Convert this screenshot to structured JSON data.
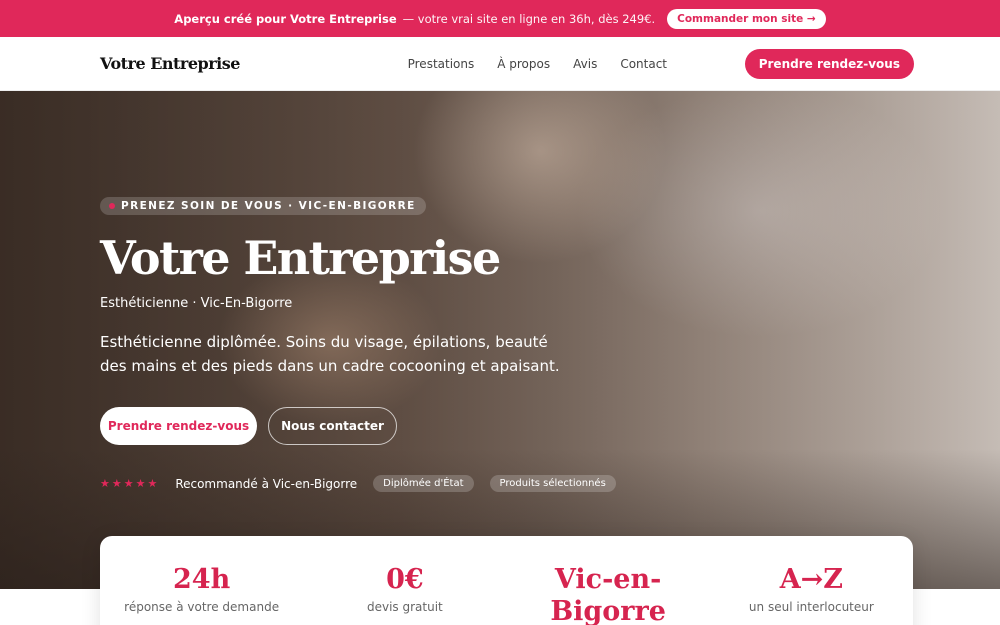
{
  "promo": {
    "strong": "Aperçu créé pour Votre Entreprise",
    "rest": "— votre vrai site en ligne en 36h, dès 249€.",
    "button": "Commander mon site →"
  },
  "nav": {
    "brand": "Votre Entreprise",
    "links": [
      "Prestations",
      "À propos",
      "Avis",
      "Contact"
    ],
    "cta": "Prendre rendez-vous"
  },
  "hero": {
    "eyebrow": "PRENEZ SOIN DE VOUS · VIC-EN-BIGORRE",
    "title": "Votre Entreprise",
    "subtitle": "Esthéticienne · Vic-En-Bigorre",
    "description": "Esthéticienne diplômée. Soins du visage, épilations, beauté des mains et des pieds dans un cadre cocooning et apaisant.",
    "primary_button": "Prendre rendez-vous",
    "secondary_button": "Nous contacter",
    "stars": "★★★★★",
    "recommendation": "Recommandé à Vic-en-Bigorre",
    "badges": [
      "Diplômée d'État",
      "Produits sélectionnés"
    ]
  },
  "stats": [
    {
      "value": "24h",
      "label": "réponse à votre demande"
    },
    {
      "value": "0€",
      "label": "devis gratuit"
    },
    {
      "value": "Vic-en-Bigorre",
      "label": ""
    },
    {
      "value": "A→Z",
      "label": "un seul interlocuteur"
    }
  ],
  "colors": {
    "accent": "#e0285a",
    "accent_dark": "#d6244f"
  }
}
